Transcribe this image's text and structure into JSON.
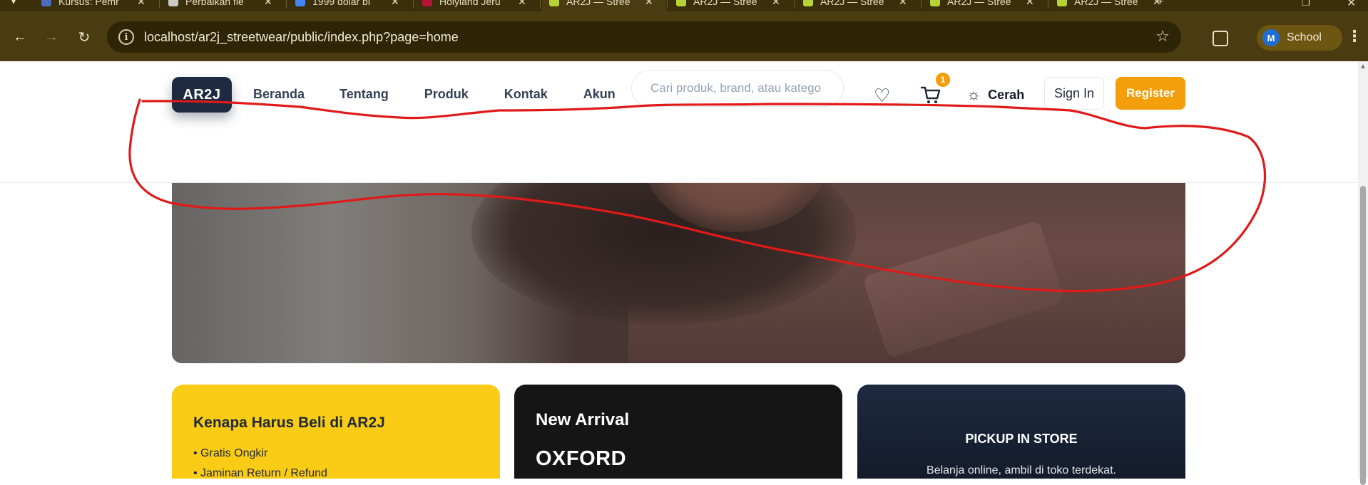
{
  "browser": {
    "tabs": [
      {
        "label": "Kursus: Pemr",
        "close": "✕",
        "color": "#4b6cc1"
      },
      {
        "label": "Perbaikan fle",
        "close": "✕",
        "color": "#c9c9c9"
      },
      {
        "label": "1999 dolar bi",
        "close": "✕",
        "color": "#4285f4"
      },
      {
        "label": "Holyland Jeru",
        "close": "✕",
        "color": "#b8123a"
      },
      {
        "label": "AR2J — Stree",
        "close": "✕",
        "color": "#b5d334"
      },
      {
        "label": "AR2J — Stree",
        "close": "✕",
        "color": "#b5d334"
      },
      {
        "label": "AR2J — Stree",
        "close": "✕",
        "color": "#b5d334"
      },
      {
        "label": "AR2J — Stree",
        "close": "✕",
        "color": "#b5d334"
      },
      {
        "label": "AR2J — Stree",
        "close": "✕",
        "color": "#b5d334"
      }
    ],
    "new_tab": "+",
    "url": "localhost/ar2j_streetwear/public/index.php?page=home",
    "profile_initial": "M",
    "profile_name": "School"
  },
  "site": {
    "logo": "AR2J",
    "nav": [
      "Beranda",
      "Tentang",
      "Produk",
      "Kontak",
      "Akun"
    ],
    "search_placeholder": "Cari produk, brand, atau katego",
    "cart_count": "1",
    "theme_label": "Cerah",
    "signin_label": "Sign In",
    "register_label": "Register",
    "accent": "#f59e0b",
    "dark": "#1e2a40"
  },
  "cards": {
    "why": {
      "title": "Kenapa Harus Beli di AR2J",
      "items": [
        "• Gratis Ongkir",
        "• Jaminan Return / Refund"
      ]
    },
    "arrival": {
      "title": "New Arrival",
      "product": "OXFORD"
    },
    "pickup": {
      "title": "PICKUP IN STORE",
      "text": "Belanja online, ambil di toko terdekat."
    }
  }
}
